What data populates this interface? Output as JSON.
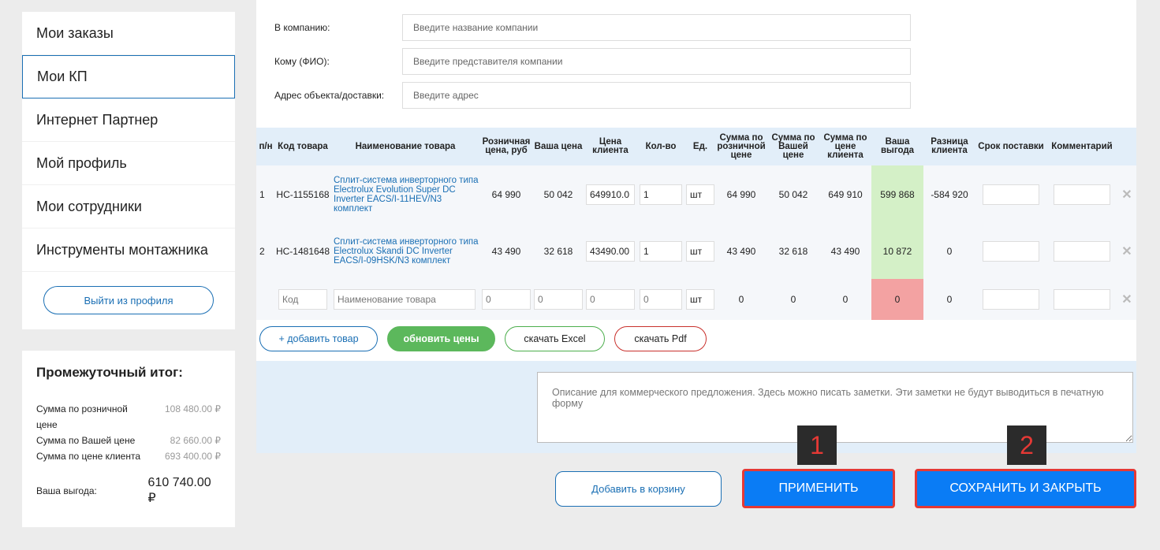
{
  "sidebar": {
    "items": [
      {
        "label": "Мои заказы"
      },
      {
        "label": "Мои КП"
      },
      {
        "label": "Интернет Партнер"
      },
      {
        "label": "Мой профиль"
      },
      {
        "label": "Мои сотрудники"
      },
      {
        "label": "Инструменты монтажника"
      }
    ],
    "logout_label": "Выйти из профиля"
  },
  "summary": {
    "title": "Промежуточный итог:",
    "retail_label": "Сумма по розничной цене",
    "retail_value": "108 480.00 ₽",
    "yours_label": "Сумма по Вашей цене",
    "yours_value": "82 660.00 ₽",
    "client_label": "Сумма по цене клиента",
    "client_value": "693 400.00 ₽",
    "profit_label": "Ваша выгода:",
    "profit_value": "610 740.00 ₽"
  },
  "form": {
    "company_label": "В компанию:",
    "company_placeholder": "Введите название компании",
    "to_label": "Кому (ФИО):",
    "to_placeholder": "Введите представителя компании",
    "address_label": "Адрес объекта/доставки:",
    "address_placeholder": "Введите адрес"
  },
  "table": {
    "headers": {
      "np": "п/н",
      "code": "Код товара",
      "name": "Наименование товара",
      "retail": "Розничная цена, руб",
      "yours": "Ваша цена",
      "client": "Цена клиента",
      "qty": "Кол-во",
      "unit": "Ед.",
      "sum_retail": "Сумма по розничной цене",
      "sum_yours": "Сумма по Вашей цене",
      "sum_client": "Сумма по цене клиента",
      "profit": "Ваша выгода",
      "diff": "Разница клиента",
      "delivery": "Срок поставки",
      "comment": "Комментарий"
    },
    "rows": [
      {
        "np": "1",
        "code": "НС-1155168",
        "name": "Сплит-система инверторного типа Electrolux Evolution Super DC Inverter EACS/I-11HEV/N3 комплект",
        "retail": "64 990",
        "yours": "50 042",
        "client": "649910.0",
        "qty": "1",
        "unit": "шт",
        "sum_retail": "64 990",
        "sum_yours": "50 042",
        "sum_client": "649 910",
        "profit": "599 868",
        "diff": "-584 920"
      },
      {
        "np": "2",
        "code": "НС-1481648",
        "name": "Сплит-система инверторного типа Electrolux Skandi DC Inverter EACS/I-09HSK/N3 комплект",
        "retail": "43 490",
        "yours": "32 618",
        "client": "43490.00",
        "qty": "1",
        "unit": "шт",
        "sum_retail": "43 490",
        "sum_yours": "32 618",
        "sum_client": "43 490",
        "profit": "10 872",
        "diff": "0"
      }
    ],
    "new_row": {
      "code_placeholder": "Код",
      "name_placeholder": "Наименование товара",
      "zero": "0",
      "unit": "шт"
    }
  },
  "actions": {
    "add_label": "+ добавить товар",
    "refresh_label": "обновить цены",
    "excel_label": "скачать Excel",
    "pdf_label": "скачать Pdf"
  },
  "description_placeholder": "Описание для коммерческого предложения. Здесь можно писать заметки. Эти заметки не будут выводиться в печатную форму",
  "footer": {
    "cart_label": "Добавить в корзину",
    "apply_label": "ПРИМЕНИТЬ",
    "save_label": "СОХРАНИТЬ И ЗАКРЫТЬ",
    "badge1": "1",
    "badge2": "2"
  },
  "colors": {
    "accent": "#0a7cf5",
    "link": "#1a6fb4",
    "highlight_border": "#e53935",
    "profit_positive": "#d4f0c7",
    "profit_zero": "#f3a2a2"
  },
  "icons": {
    "remove": "close-icon"
  }
}
